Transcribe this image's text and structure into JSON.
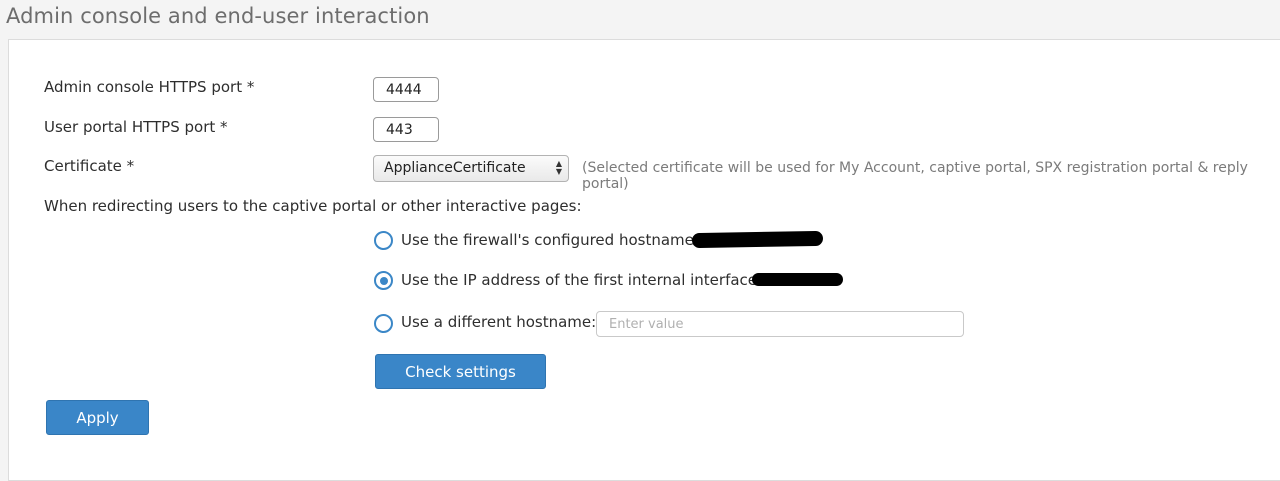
{
  "section": {
    "title": "Admin console and end-user interaction"
  },
  "admin_port": {
    "label": "Admin console HTTPS port *",
    "value": "4444"
  },
  "user_port": {
    "label": "User portal HTTPS port *",
    "value": "443"
  },
  "certificate": {
    "label": "Certificate *",
    "selected": "ApplianceCertificate",
    "hint": "(Selected certificate will be used for My Account, captive portal, SPX registration portal & reply portal)"
  },
  "redirect": {
    "label": "When redirecting users to the captive portal or other interactive pages:",
    "options": [
      {
        "label": "Use the firewall's configured hostname:",
        "checked": false
      },
      {
        "label": "Use the IP address of the first internal interface:",
        "checked": true
      },
      {
        "label": "Use a different hostname:",
        "checked": false
      }
    ],
    "hostname_placeholder": "Enter value",
    "hostname_value": ""
  },
  "buttons": {
    "check_settings": "Check settings",
    "apply": "Apply"
  },
  "colors": {
    "accent": "#3a86c8",
    "button_border": "#2f74b0",
    "redaction": "#000000"
  }
}
